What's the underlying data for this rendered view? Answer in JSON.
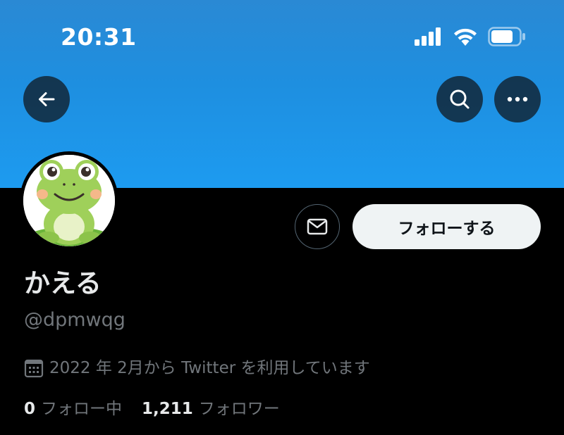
{
  "status_bar": {
    "time": "20:31",
    "icons": [
      "signal-icon",
      "wifi-icon",
      "battery-icon"
    ]
  },
  "nav": {
    "back_icon": "arrow-left-icon",
    "search_icon": "search-icon",
    "more_icon": "more-horizontal-icon"
  },
  "colors": {
    "banner": "#1d9bf0",
    "background": "#000000",
    "primary_text": "#e7e9ea",
    "secondary_text": "#71767b",
    "follow_button_bg": "#eff3f4"
  },
  "profile": {
    "display_name": "かえる",
    "handle": "@dpmwqg",
    "joined": "2022 年 2月から Twitter を利用しています",
    "avatar": "frog-avatar",
    "follow_button_label": "フォローする",
    "message_icon": "envelope-icon"
  },
  "stats": {
    "following_count": "0",
    "following_label": "フォロー中",
    "followers_count": "1,211",
    "followers_label": "フォロワー"
  }
}
